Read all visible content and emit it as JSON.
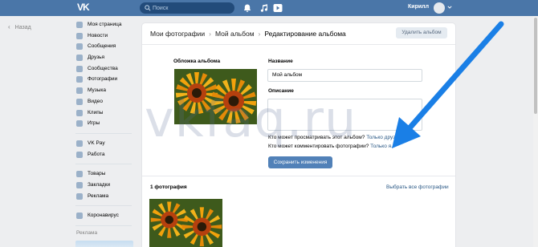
{
  "topbar": {
    "logo_text": "VK",
    "search_placeholder": "Поиск",
    "user_name": "Кирилл"
  },
  "back_label": "Назад",
  "sidebar": {
    "items": [
      {
        "label": "Моя страница",
        "icon": "home-icon"
      },
      {
        "label": "Новости",
        "icon": "news-icon"
      },
      {
        "label": "Сообщения",
        "icon": "messages-icon"
      },
      {
        "label": "Друзья",
        "icon": "friends-icon"
      },
      {
        "label": "Сообщества",
        "icon": "communities-icon"
      },
      {
        "label": "Фотографии",
        "icon": "camera-icon"
      },
      {
        "label": "Музыка",
        "icon": "music-icon"
      },
      {
        "label": "Видео",
        "icon": "video-icon"
      },
      {
        "label": "Клипы",
        "icon": "clips-icon"
      },
      {
        "label": "Игры",
        "icon": "games-icon"
      }
    ],
    "items2": [
      {
        "label": "VK Pay",
        "icon": "vkpay-icon"
      },
      {
        "label": "Работа",
        "icon": "work-icon"
      }
    ],
    "items3": [
      {
        "label": "Товары",
        "icon": "goods-icon"
      },
      {
        "label": "Закладки",
        "icon": "bookmark-icon"
      },
      {
        "label": "Реклама",
        "icon": "ads-icon"
      }
    ],
    "items4": [
      {
        "label": "Коронавирус",
        "icon": "coronavirus-icon"
      }
    ],
    "ads_label": "Реклама"
  },
  "main": {
    "breadcrumbs": [
      "Мои фотографии",
      "Мой альбом",
      "Редактирование альбома"
    ],
    "delete_button": "Удалить альбом",
    "cover_label": "Обложка альбома",
    "name_label": "Название",
    "name_value": "Мой альбом",
    "description_label": "Описание",
    "privacy_view_text": "Кто может просматривать этот альбом?",
    "privacy_view_value": "Только друзья",
    "privacy_comment_text": "Кто может комментировать фотографии?",
    "privacy_comment_value": "Только я.",
    "save_button": "Сохранить изменения",
    "photo_count": "1 фотография",
    "select_all": "Выбрать все фотографии"
  },
  "watermark": "vkfaq.ru",
  "colors": {
    "topbar": "#4a76a8",
    "accent_button": "#5181b8",
    "link": "#2a5885",
    "arrow": "#1a7fe6"
  }
}
